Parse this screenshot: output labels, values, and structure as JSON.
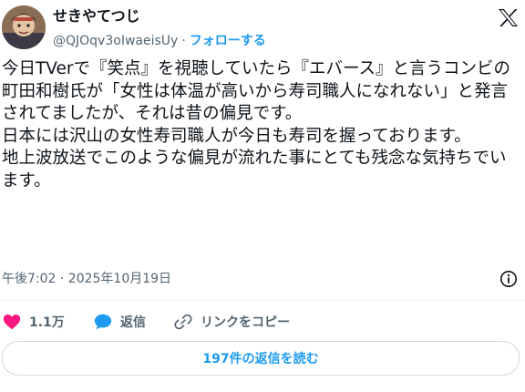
{
  "author": {
    "display_name": "せきやてつじ",
    "handle": "@QJOqv3oIwaeisUy",
    "separator": "·",
    "follow_label": "フォローする"
  },
  "tweet": {
    "text": "今日TVerで『笑点』を視聴していたら『エバース』と言うコンビの町田和樹氏が「女性は体温が高いから寿司職人になれない」と発言されてましたが、それは昔の偏見です。\n日本には沢山の女性寿司職人が今日も寿司を握っております。\n地上波放送でこのような偏見が流れた事にとても残念な気持ちでいます。",
    "timestamp": "午後7:02 · 2025年10月19日"
  },
  "actions": {
    "likes_count": "1.1万",
    "reply_label": "返信",
    "copy_link_label": "リンクをコピー"
  },
  "replies_button_label": "197件の返信を読む",
  "colors": {
    "accent": "#1d9bf0",
    "like": "#f91880",
    "secondary_text": "#536471"
  }
}
